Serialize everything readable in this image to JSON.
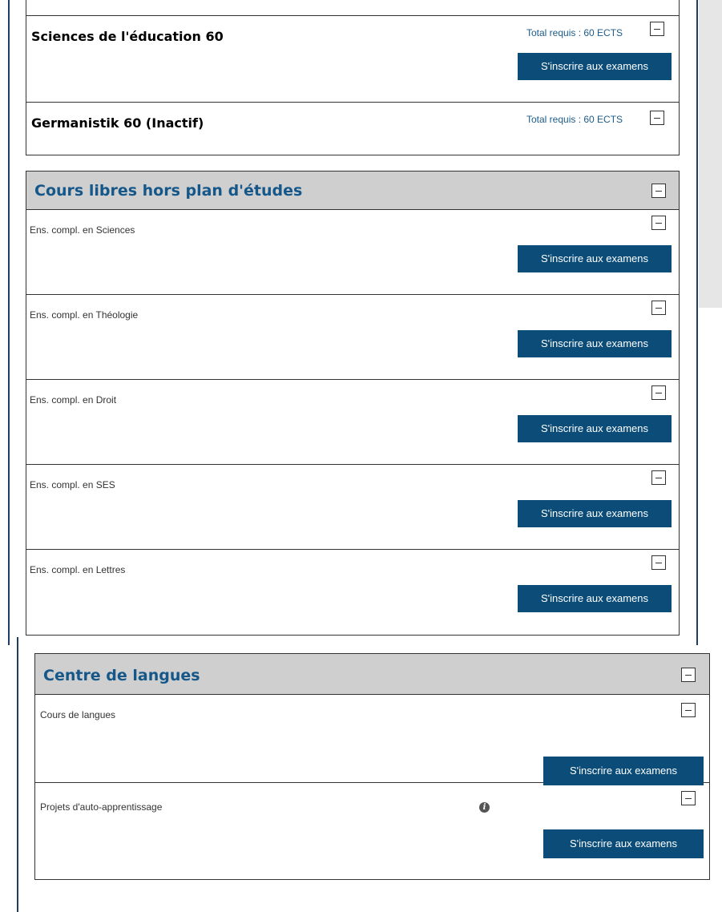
{
  "programs": [
    {
      "title": "Sciences de l'éducation 60",
      "ects": "Total requis : 60 ECTS",
      "button": "S'inscrire aux examens"
    },
    {
      "title": "Germanistik 60 (Inactif)",
      "ects": "Total requis : 60 ECTS"
    }
  ],
  "free_courses": {
    "title": "Cours libres hors plan d'études",
    "items": [
      {
        "label": "Ens. compl. en Sciences",
        "button": "S'inscrire aux examens"
      },
      {
        "label": "Ens. compl. en Théologie",
        "button": "S'inscrire aux examens"
      },
      {
        "label": "Ens. compl. en Droit",
        "button": "S'inscrire aux examens"
      },
      {
        "label": "Ens. compl. en SES",
        "button": "S'inscrire aux examens"
      },
      {
        "label": "Ens. compl. en Lettres",
        "button": "S'inscrire aux examens"
      }
    ]
  },
  "language_center": {
    "title": "Centre de langues",
    "items": [
      {
        "label": "Cours de langues",
        "button": "S'inscrire aux examens"
      },
      {
        "label": "Projets d'auto-apprentissage",
        "button": "S'inscrire aux examens",
        "icon": "info-icon"
      }
    ]
  },
  "colors": {
    "primary_button": "#0b4d78",
    "section_title": "#16578a",
    "header_bg": "#cfcfcf"
  }
}
